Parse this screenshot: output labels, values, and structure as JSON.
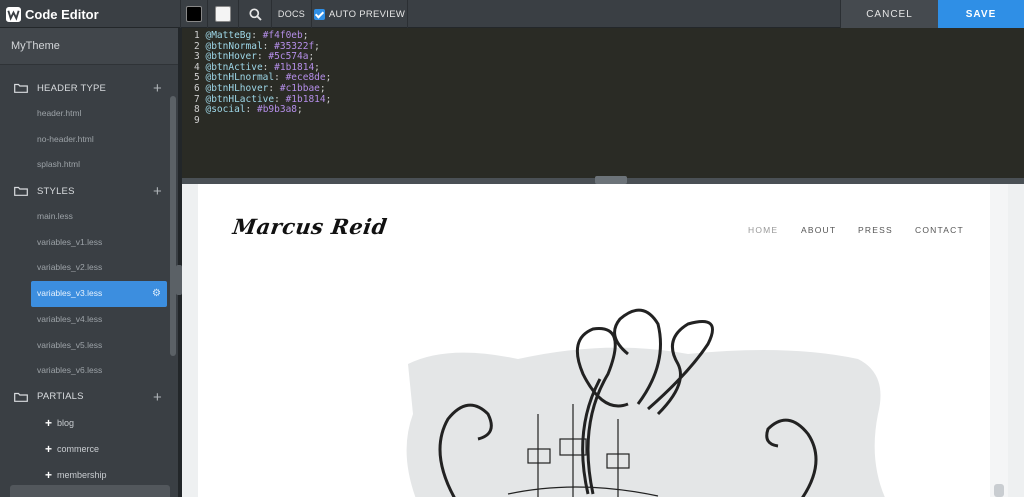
{
  "app": {
    "title": "Code Editor"
  },
  "toolbar": {
    "swatch_dark": "#000000",
    "swatch_light": "#f4f4f4",
    "docs_label": "DOCS",
    "auto_preview_label": "AUTO PREVIEW",
    "auto_preview_checked": true,
    "cancel_label": "CANCEL",
    "save_label": "SAVE"
  },
  "sidebar": {
    "theme_name": "MyTheme",
    "sections": [
      {
        "title": "HEADER TYPE",
        "files": [
          "header.html",
          "no-header.html",
          "splash.html"
        ]
      },
      {
        "title": "STYLES",
        "files": [
          "main.less",
          "variables_v1.less",
          "variables_v2.less",
          "variables_v3.less",
          "variables_v4.less",
          "variables_v5.less",
          "variables_v6.less"
        ],
        "active": "variables_v3.less"
      },
      {
        "title": "PARTIALS",
        "items": [
          "blog",
          "commerce",
          "membership"
        ]
      }
    ]
  },
  "code": {
    "lines": [
      {
        "n": "1",
        "var": "@MatteBg",
        "val": "#f4f0eb"
      },
      {
        "n": "2",
        "var": "@btnNormal",
        "val": "#35322f"
      },
      {
        "n": "3",
        "var": "@btnHover",
        "val": "#5c574a"
      },
      {
        "n": "4",
        "var": "@btnActive",
        "val": "#1b1814"
      },
      {
        "n": "5",
        "var": "@btnHLnormal",
        "val": "#ece8de"
      },
      {
        "n": "6",
        "var": "@btnHLhover",
        "val": "#c1bbae"
      },
      {
        "n": "7",
        "var": "@btnHLactive",
        "val": "#1b1814"
      },
      {
        "n": "8",
        "var": "@social",
        "val": "#b9b3a8"
      },
      {
        "n": "9",
        "var": "",
        "val": ""
      }
    ]
  },
  "preview": {
    "site_name": "Marcus Reid",
    "nav": [
      "HOME",
      "ABOUT",
      "PRESS",
      "CONTACT"
    ],
    "active_nav": "HOME"
  },
  "colors": {
    "accent": "#2f8fe6",
    "sidebar_bg": "#3a3f44",
    "code_bg": "#2a2b25"
  }
}
